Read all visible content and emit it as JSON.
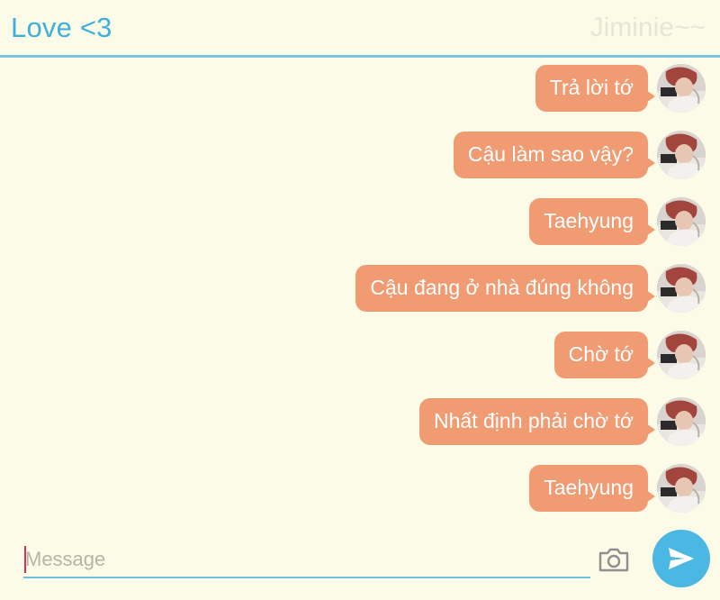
{
  "header": {
    "title": "Love <3",
    "contact_name": "Jiminie~~"
  },
  "messages": [
    {
      "text": "Trả lời tớ",
      "sender": "me"
    },
    {
      "text": "Cậu làm sao vậy?",
      "sender": "me"
    },
    {
      "text": "Taehyung",
      "sender": "me"
    },
    {
      "text": "Cậu đang ở nhà đúng không",
      "sender": "me"
    },
    {
      "text": "Chờ tớ",
      "sender": "me"
    },
    {
      "text": "Nhất định phải chờ tớ",
      "sender": "me"
    },
    {
      "text": "Taehyung",
      "sender": "me"
    }
  ],
  "composer": {
    "placeholder": "Message",
    "value": ""
  },
  "icons": {
    "camera": "camera-icon",
    "send": "send-icon",
    "avatar": "avatar-photo"
  },
  "colors": {
    "background": "#fcfbe7",
    "accent": "#3fb0dc",
    "bubble": "#f19b73",
    "send_button": "#4ab8e2"
  }
}
